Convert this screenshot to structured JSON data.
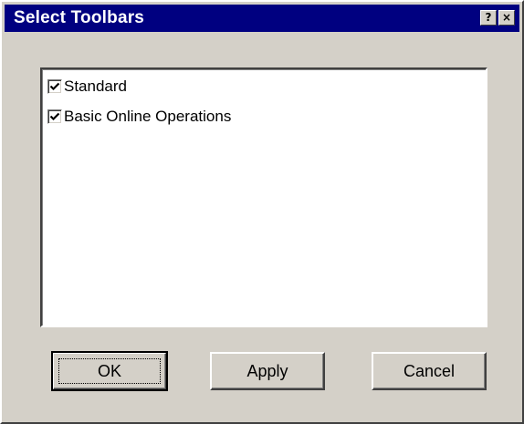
{
  "window": {
    "title": "Select Toolbars",
    "help_icon": "question-mark",
    "close_icon": "x-mark"
  },
  "toolbars": {
    "items": [
      {
        "label": "Standard",
        "checked": true
      },
      {
        "label": "Basic Online Operations",
        "checked": true
      }
    ]
  },
  "buttons": {
    "ok": "OK",
    "apply": "Apply",
    "cancel": "Cancel"
  },
  "colors": {
    "titlebar": "#000080",
    "face": "#d4d0c8"
  }
}
